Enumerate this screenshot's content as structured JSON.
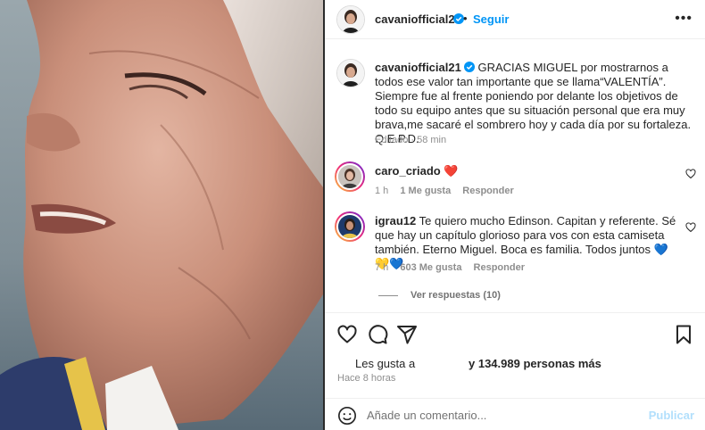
{
  "post": {
    "author": "cavaniofficial21",
    "follow_label": "Seguir",
    "separator": "•",
    "more_label": "•••"
  },
  "caption": {
    "username": "cavaniofficial21",
    "text": "GRACIAS MIGUEL por mostrarnos a todos ese valor tan importante que se llama“VALENTÍA”. Siempre fue al frente poniendo por delante los objetivos de todo su equipo antes que su situación personal que era muy brava,me sacaré el sombrero hoy y cada día por su fortaleza. Q.E.P.D.",
    "meta": "Editado · 58 min"
  },
  "comments": [
    {
      "username": "caro_criado",
      "text": "",
      "emoji": "❤️",
      "time": "1 h",
      "likes": "1 Me gusta",
      "reply_label": "Responder"
    },
    {
      "username": "igrau12",
      "text": "Te quiero mucho Edinson. Capitan y referente. Sé que hay un capítulo glorioso para vos con esta camiseta también. Eterno Miguel. Boca es familia. Todos juntos",
      "emoji": "💙💛💙",
      "time": "7 h",
      "likes": "603 Me gusta",
      "reply_label": "Responder"
    }
  ],
  "replies_label": "Ver respuestas (10)",
  "actions": {
    "like_icon": "heart-outline-icon",
    "comment_icon": "comment-icon",
    "share_icon": "send-icon",
    "save_icon": "bookmark-icon"
  },
  "likes": {
    "prefix": "Les gusta a",
    "count": "y 134.989 personas más"
  },
  "time_ago": "Hace 8 horas",
  "add_comment": {
    "placeholder": "Añade un comentario...",
    "post_label": "Publicar"
  },
  "colors": {
    "accent": "#0095f6",
    "verified": "#0095f6",
    "muted": "#8e8e8e",
    "post_disabled": "#b2dffc"
  }
}
